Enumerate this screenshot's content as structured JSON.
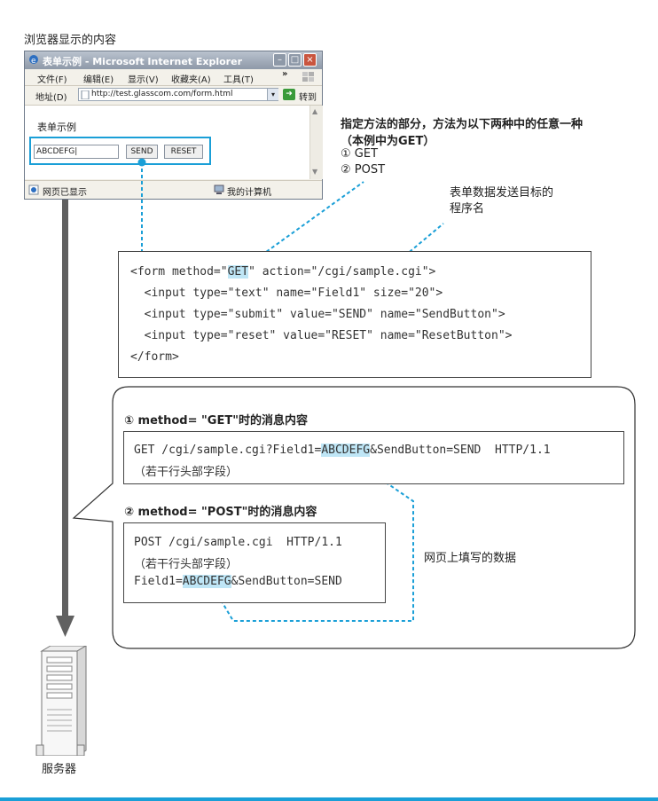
{
  "caption_browser": "浏览器显示的内容",
  "browser": {
    "title": "表单示例 - Microsoft Internet Explorer",
    "menu": [
      "文件(F)",
      "编辑(E)",
      "显示(V)",
      "收藏夹(A)",
      "工具(T)"
    ],
    "more": "»",
    "address_label": "地址(D)",
    "address_value": "http://test.glasscom.com/form.html",
    "go_label": "转到",
    "form_title": "表单示例",
    "field_value": "ABCDEFG",
    "send_label": "SEND",
    "reset_label": "RESET",
    "status_left": "网页已显示",
    "status_right": "我的计算机"
  },
  "method_note": {
    "line1": "指定方法的部分，方法为以下两种中的任意一种",
    "line2": "（本例中为GET）",
    "opt1": "① GET",
    "opt2": "② POST"
  },
  "action_note": {
    "line1": "表单数据发送目标的",
    "line2": "程序名"
  },
  "code": {
    "l1a": "<form method=\"",
    "l1hl": "GET",
    "l1b": "\" action=\"/cgi/sample.cgi\">",
    "l2": "  <input type=\"text\" name=\"Field1\" size=\"20\">",
    "l3": "  <input type=\"submit\" value=\"SEND\" name=\"SendButton\">",
    "l4": "  <input type=\"reset\" value=\"RESET\" name=\"ResetButton\">",
    "l5": "</form>"
  },
  "get_section": {
    "heading": "① method= \"GET\"时的消息内容",
    "line_a": "GET /cgi/sample.cgi?Field1=",
    "line_hl": "ABCDEFG",
    "line_b": "&SendButton=SEND  HTTP/1.1",
    "headers": "（若干行头部字段）"
  },
  "post_section": {
    "heading": "② method= \"POST\"时的消息内容",
    "line1": "POST /cgi/sample.cgi  HTTP/1.1",
    "headers": "（若干行头部字段）",
    "body_a": "Field1=",
    "body_hl": "ABCDEFG",
    "body_b": "&SendButton=SEND"
  },
  "data_note": "网页上填写的数据",
  "server_label": "服务器",
  "colors": {
    "accent": "#1a9fd7",
    "highlight": "#bfe6f6",
    "arrow": "#606060"
  }
}
